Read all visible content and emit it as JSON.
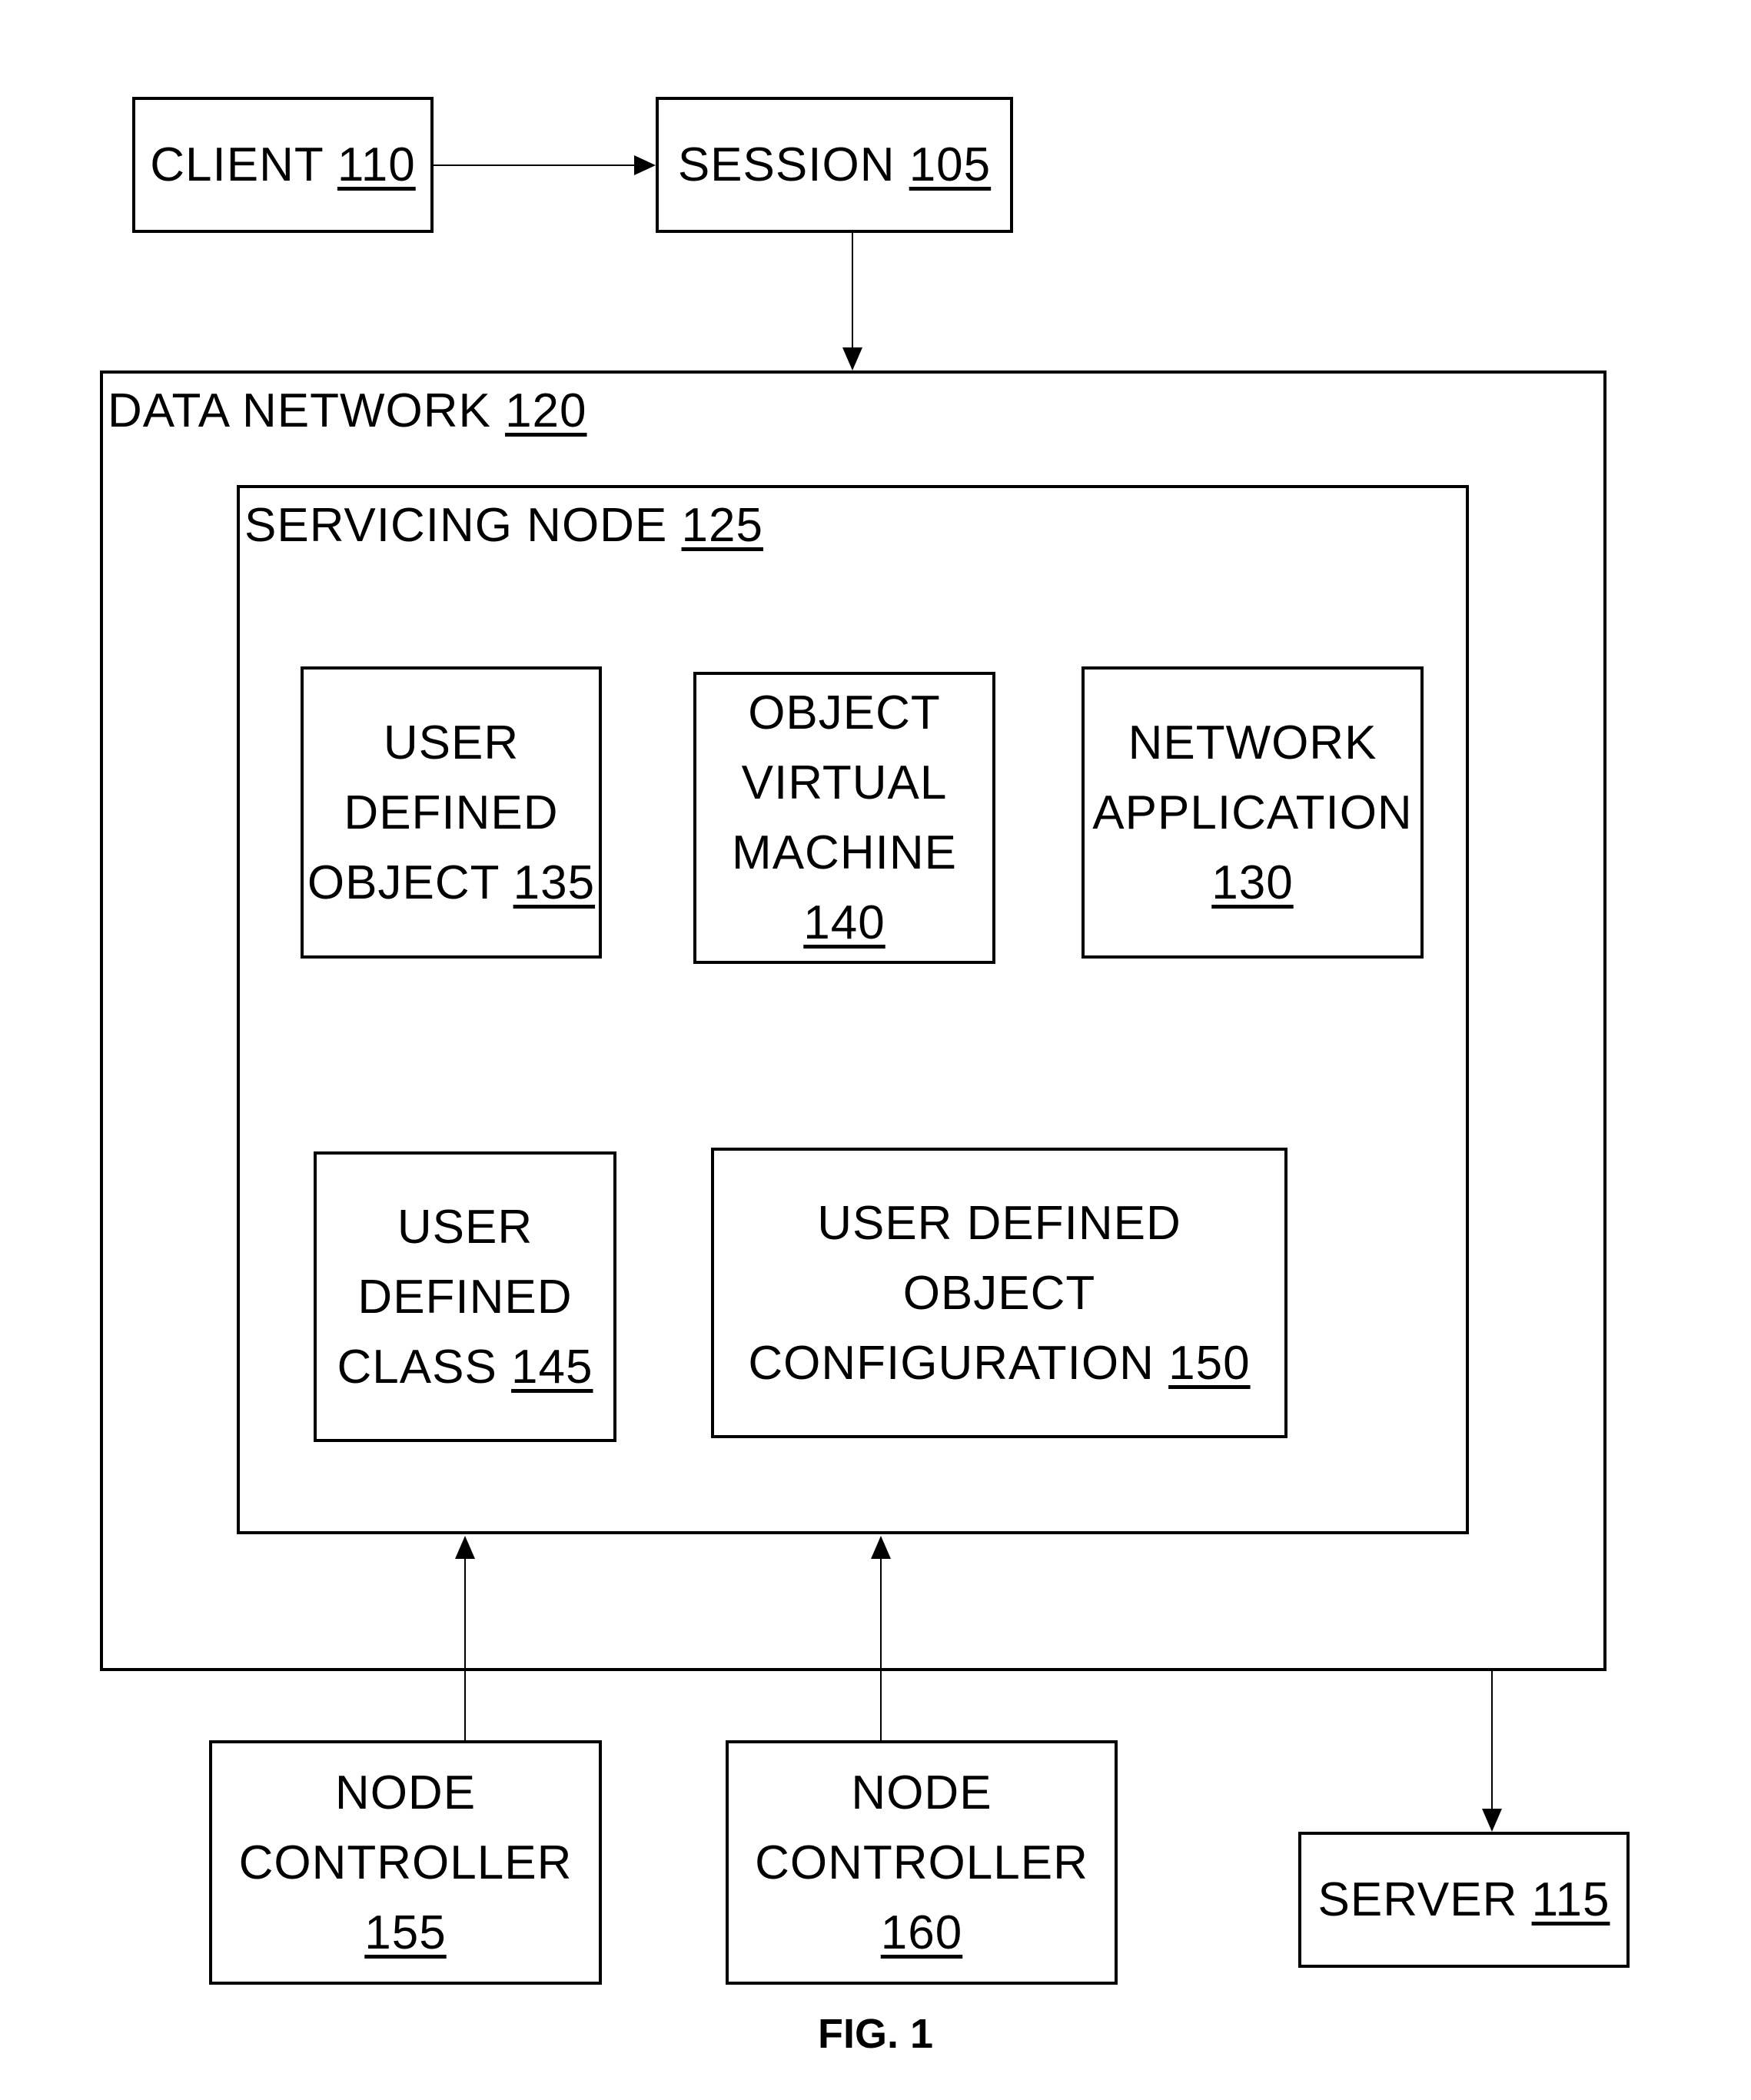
{
  "figure_label": "FIG. 1",
  "nodes": {
    "client": {
      "text": "CLIENT",
      "ref": "110"
    },
    "session": {
      "text": "SESSION",
      "ref": "105"
    },
    "data_network": {
      "text": "DATA NETWORK",
      "ref": "120"
    },
    "servicing_node": {
      "text": "SERVICING NODE",
      "ref": "125"
    },
    "user_defined_object": {
      "lines": [
        "USER",
        "DEFINED",
        "OBJECT"
      ],
      "ref": "135"
    },
    "object_virtual_machine": {
      "lines": [
        "OBJECT",
        "VIRTUAL",
        "MACHINE"
      ],
      "ref": "140"
    },
    "network_application": {
      "lines": [
        "NETWORK",
        "APPLICATION"
      ],
      "ref": "130"
    },
    "user_defined_class": {
      "lines": [
        "USER",
        "DEFINED",
        "CLASS"
      ],
      "ref": "145"
    },
    "user_defined_object_configuration": {
      "lines": [
        "USER DEFINED OBJECT",
        "CONFIGURATION"
      ],
      "ref": "150"
    },
    "node_controller_155": {
      "lines": [
        "NODE",
        "CONTROLLER"
      ],
      "ref": "155"
    },
    "node_controller_160": {
      "lines": [
        "NODE",
        "CONTROLLER"
      ],
      "ref": "160"
    },
    "server": {
      "text": "SERVER",
      "ref": "115"
    }
  },
  "edges": [
    {
      "from": "client",
      "to": "session"
    },
    {
      "from": "session",
      "to": "data_network"
    },
    {
      "from": "node_controller_155",
      "to": "servicing_node"
    },
    {
      "from": "node_controller_160",
      "to": "servicing_node"
    },
    {
      "from": "data_network",
      "to": "server"
    }
  ]
}
